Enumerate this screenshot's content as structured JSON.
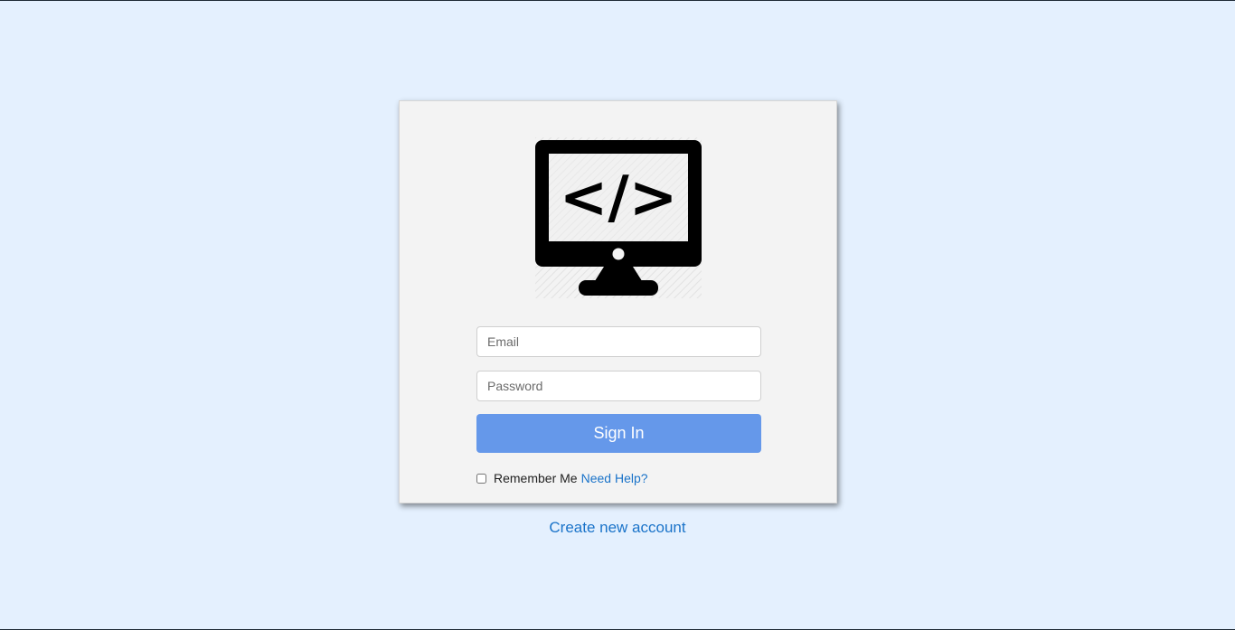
{
  "logo": {
    "icon": "monitor-code-icon",
    "code_glyph": "</>"
  },
  "form": {
    "email_placeholder": "Email",
    "password_placeholder": "Password",
    "signin_label": "Sign In",
    "remember_label": "Remember Me",
    "help_link": "Need Help?"
  },
  "footer": {
    "create_account_link": "Create new account"
  },
  "colors": {
    "page_background": "#e4f0fe",
    "card_background": "#f3f3f3",
    "button_background": "#6598ea",
    "link": "#1a73c9"
  }
}
